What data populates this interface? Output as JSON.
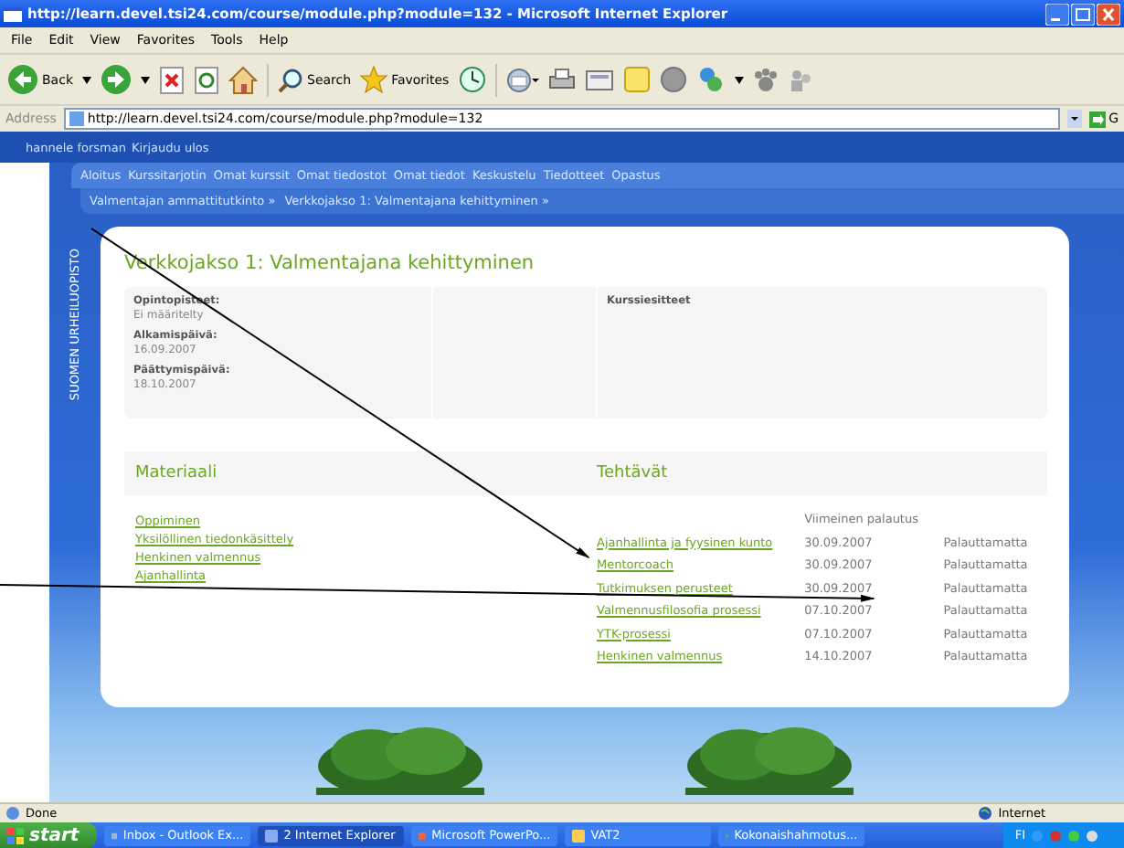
{
  "window": {
    "title": "http://learn.devel.tsi24.com/course/module.php?module=132 - Microsoft Internet Explorer"
  },
  "menu": [
    "File",
    "Edit",
    "View",
    "Favorites",
    "Tools",
    "Help"
  ],
  "toolbar": {
    "back": "Back",
    "search": "Search",
    "favorites": "Favorites"
  },
  "address": {
    "label": "Address",
    "url": "http://learn.devel.tsi24.com/course/module.php?module=132",
    "go": "G"
  },
  "page": {
    "user": "hannele forsman",
    "logout": "Kirjaudu ulos",
    "nav": [
      "Aloitus",
      "Kurssitarjotin",
      "Omat kurssit",
      "Omat tiedostot",
      "Omat tiedot",
      "Keskustelu",
      "Tiedotteet",
      "Opastus"
    ],
    "breadcrumb": [
      "Valmentajan ammattitutkinto »",
      "Verkkojakso 1: Valmentajana kehittyminen »"
    ],
    "side_logo": "SUOMEN URHEILUOPISTO",
    "title": "Verkkojakso 1: Valmentajana kehittyminen",
    "info": {
      "fields": [
        {
          "label": "Opintopisteet:",
          "value": "Ei määritelty"
        },
        {
          "label": "Alkamispäivä:",
          "value": "16.09.2007"
        },
        {
          "label": "Päättymispäivä:",
          "value": "18.10.2007"
        }
      ],
      "column_3": "Kurssiesitteet"
    },
    "materials": {
      "heading": "Materiaali",
      "links": [
        "Oppiminen",
        "Yksilöllinen tiedonkäsittely",
        "Henkinen valmennus",
        "Ajanhallinta"
      ]
    },
    "tasks": {
      "heading": "Tehtävät",
      "deadline_header": "Viimeinen palautus",
      "rows": [
        {
          "name": "Ajanhallinta ja fyysinen kunto",
          "deadline": "30.09.2007",
          "status": "Palauttamatta"
        },
        {
          "name": "Mentorcoach",
          "deadline": "30.09.2007",
          "status": "Palauttamatta"
        },
        {
          "name": "Tutkimuksen perusteet",
          "deadline": "30.09.2007",
          "status": "Palauttamatta"
        },
        {
          "name": "Valmennusfilosofia prosessi",
          "deadline": "07.10.2007",
          "status": "Palauttamatta"
        },
        {
          "name": "YTK-prosessi",
          "deadline": "07.10.2007",
          "status": "Palauttamatta"
        },
        {
          "name": "Henkinen valmennus",
          "deadline": "14.10.2007",
          "status": "Palauttamatta"
        }
      ]
    }
  },
  "status_bar": {
    "text": "Done",
    "zone": "Internet"
  },
  "taskbar": {
    "start": "start",
    "items": [
      {
        "label": "Inbox - Outlook Ex...",
        "selected": false
      },
      {
        "label": "2 Internet Explorer",
        "selected": true
      },
      {
        "label": "Microsoft PowerPo...",
        "selected": false
      },
      {
        "label": "VAT2",
        "selected": false
      },
      {
        "label": "Kokonaishahmotus...",
        "selected": false
      }
    ],
    "tray": "FI"
  }
}
